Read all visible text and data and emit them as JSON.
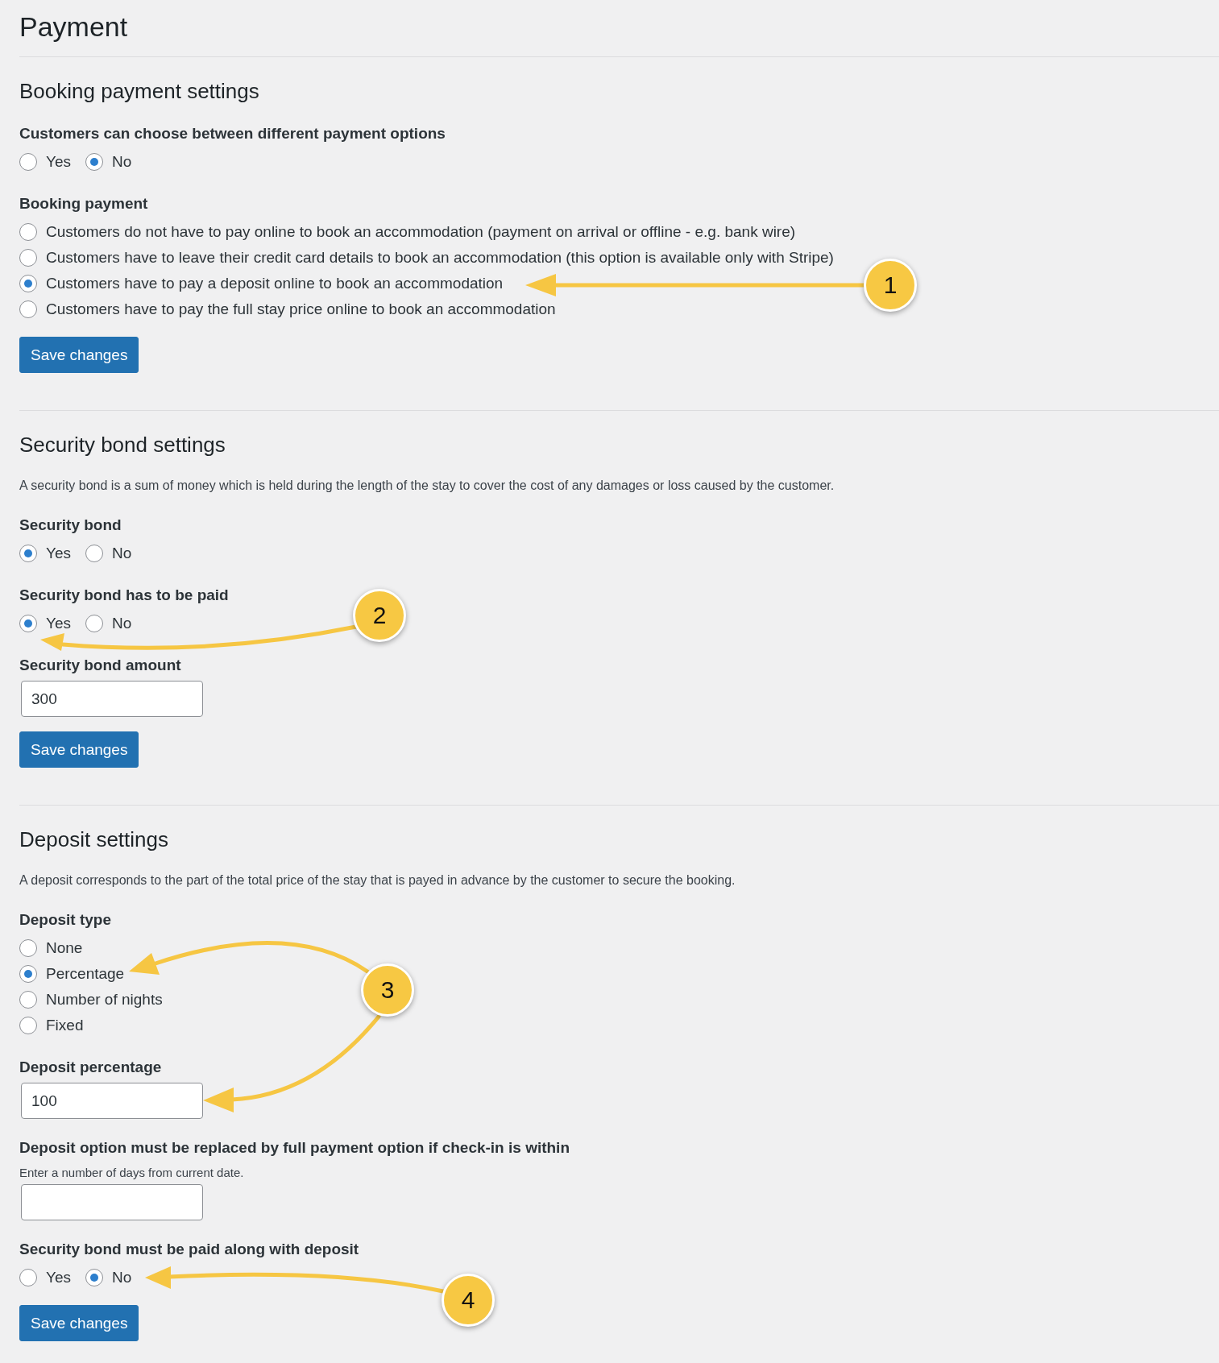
{
  "title": "Payment",
  "sections": [
    {
      "heading": "Booking payment settings",
      "fields": [
        {
          "kind": "inline",
          "label": "Customers can choose between different payment options",
          "options": [
            {
              "label": "Yes",
              "selected": false
            },
            {
              "label": "No",
              "selected": true
            }
          ]
        },
        {
          "kind": "stacked",
          "label": "Booking payment",
          "options": [
            {
              "label": "Customers do not have to pay online to book an accommodation (payment on arrival or offline - e.g. bank wire)",
              "selected": false
            },
            {
              "label": "Customers have to leave their credit card details to book an accommodation (this option is available only with Stripe)",
              "selected": false
            },
            {
              "label": "Customers have to pay a deposit online to book an accommodation",
              "selected": true
            },
            {
              "label": "Customers have to pay the full stay price online to book an accommodation",
              "selected": false
            }
          ]
        }
      ],
      "button": "Save changes"
    },
    {
      "heading": "Security bond settings",
      "description": "A security bond is a sum of money which is held during the length of the stay to cover the cost of any damages or loss caused by the customer.",
      "fields": [
        {
          "kind": "inline",
          "label": "Security bond",
          "options": [
            {
              "label": "Yes",
              "selected": true
            },
            {
              "label": "No",
              "selected": false
            }
          ]
        },
        {
          "kind": "inline",
          "label": "Security bond has to be paid",
          "options": [
            {
              "label": "Yes",
              "selected": true
            },
            {
              "label": "No",
              "selected": false
            }
          ]
        },
        {
          "kind": "text",
          "label": "Security bond amount",
          "value": "300"
        }
      ],
      "button": "Save changes"
    },
    {
      "heading": "Deposit settings",
      "description": "A deposit corresponds to the part of the total price of the stay that is payed in advance by the customer to secure the booking.",
      "fields": [
        {
          "kind": "stacked",
          "label": "Deposit type",
          "options": [
            {
              "label": "None",
              "selected": false
            },
            {
              "label": "Percentage",
              "selected": true
            },
            {
              "label": "Number of nights",
              "selected": false
            },
            {
              "label": "Fixed",
              "selected": false
            }
          ]
        },
        {
          "kind": "text",
          "label": "Deposit percentage",
          "value": "100"
        },
        {
          "kind": "text",
          "label": "Deposit option must be replaced by full payment option if check-in is within",
          "hint": "Enter a number of days from current date."
        },
        {
          "kind": "inline",
          "label": "Security bond must be paid along with deposit",
          "options": [
            {
              "label": "Yes",
              "selected": false
            },
            {
              "label": "No",
              "selected": true
            }
          ]
        }
      ],
      "button": "Save changes"
    }
  ],
  "callouts": [
    {
      "number": "1"
    },
    {
      "number": "2"
    },
    {
      "number": "3"
    },
    {
      "number": "4"
    }
  ]
}
